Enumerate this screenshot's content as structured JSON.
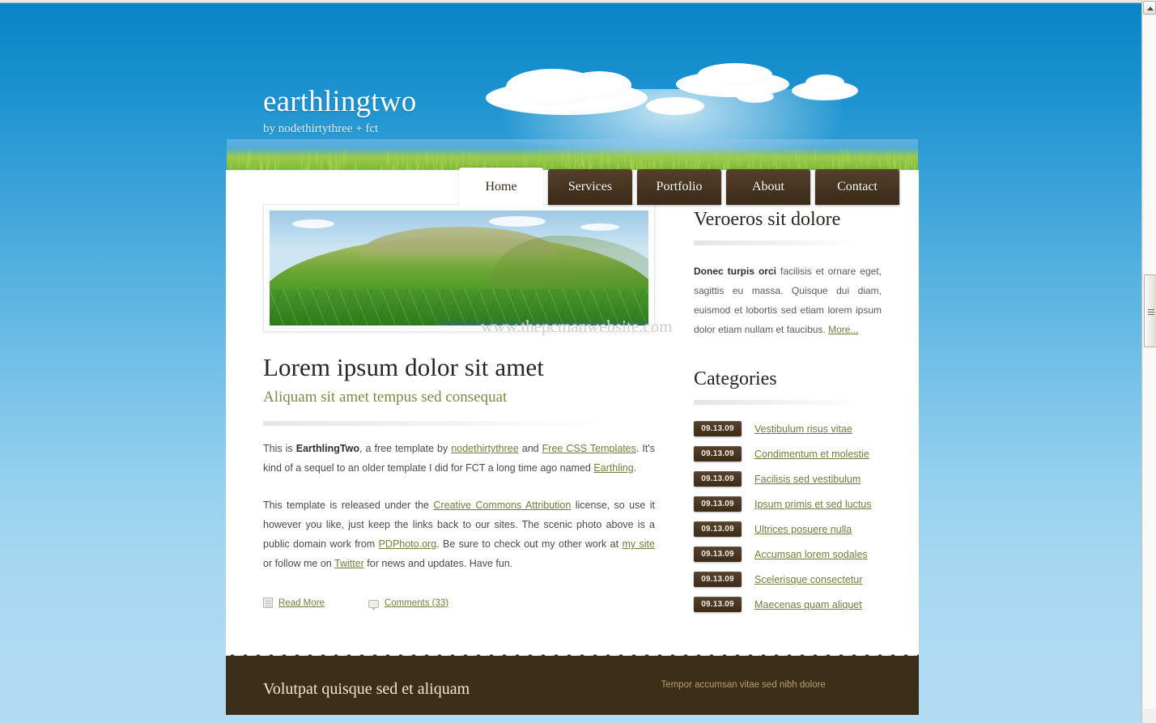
{
  "site": {
    "title": "earthlingtwo",
    "tagline": "by nodethirtythree + fct"
  },
  "nav": {
    "items": [
      {
        "label": "Home",
        "active": true
      },
      {
        "label": "Services",
        "active": false
      },
      {
        "label": "Portfolio",
        "active": false
      },
      {
        "label": "About",
        "active": false
      },
      {
        "label": "Contact",
        "active": false
      }
    ]
  },
  "watermark": "www.thepcmanwebsite.com",
  "post": {
    "title": "Lorem ipsum dolor sit amet",
    "subtitle": "Aliquam sit amet tempus sed consequat",
    "paragraph1": {
      "t1": "This is ",
      "b1": "EarthlingTwo",
      "t2": ", a free template by ",
      "a1": "nodethirtythree",
      "t3": " and ",
      "a2": "Free CSS Templates",
      "t4": ". It's kind of a sequel to an older template I did for FCT a long time ago named ",
      "a3": "Earthling",
      "t5": "."
    },
    "paragraph2": {
      "t1": "This template is released under the ",
      "a1": "Creative Commons Attribution",
      "t2": " license, so use it however you like, just keep the links back to our sites. The scenic photo above is a public domain work from ",
      "a2": "PDPhoto.org",
      "t3": ". Be sure to check out my other work at ",
      "a3": "my site",
      "t4": " or follow me on ",
      "a4": "Twitter",
      "t5": " for news and updates. Have fun."
    },
    "meta": {
      "read_more": "Read More",
      "comments": "Comments (33)"
    }
  },
  "sidebar": {
    "intro": {
      "heading": "Veroeros sit dolore",
      "bold_lead": "Donec turpis orci",
      "body": " facilisis et ornare eget, sagittis eu massa. Quisque dui diam, euismod et lobortis sed etiam lorem ipsum dolor etiam nullam et faucibus. ",
      "more_label": "More..."
    },
    "categories": {
      "heading": "Categories",
      "items": [
        {
          "date": "09.13.09",
          "label": "Vestibulum risus vitae"
        },
        {
          "date": "09.13.09",
          "label": "Condimentum et molestie"
        },
        {
          "date": "09.13.09",
          "label": "Facilisis sed vestibulum"
        },
        {
          "date": "09.13.09",
          "label": "Ipsum primis et sed luctus"
        },
        {
          "date": "09.13.09",
          "label": "Ultrices posuere nulla"
        },
        {
          "date": "09.13.09",
          "label": "Accumsan lorem sodales"
        },
        {
          "date": "09.13.09",
          "label": "Scelerisque consectetur"
        },
        {
          "date": "09.13.09",
          "label": "Maecenas quam aliquet"
        }
      ]
    }
  },
  "footer": {
    "left_heading": "Volutpat quisque sed et aliquam",
    "right_heading": "Tempor accumsan vitae sed nibh dolore"
  },
  "colors": {
    "sky_top": "#0a84c4",
    "sky_bottom": "#b3dbf2",
    "tab_brown": "#453320",
    "footer_brown": "#3d2e1a",
    "link_olive": "#6f7d3c",
    "subtitle_olive": "#7b8a45"
  }
}
